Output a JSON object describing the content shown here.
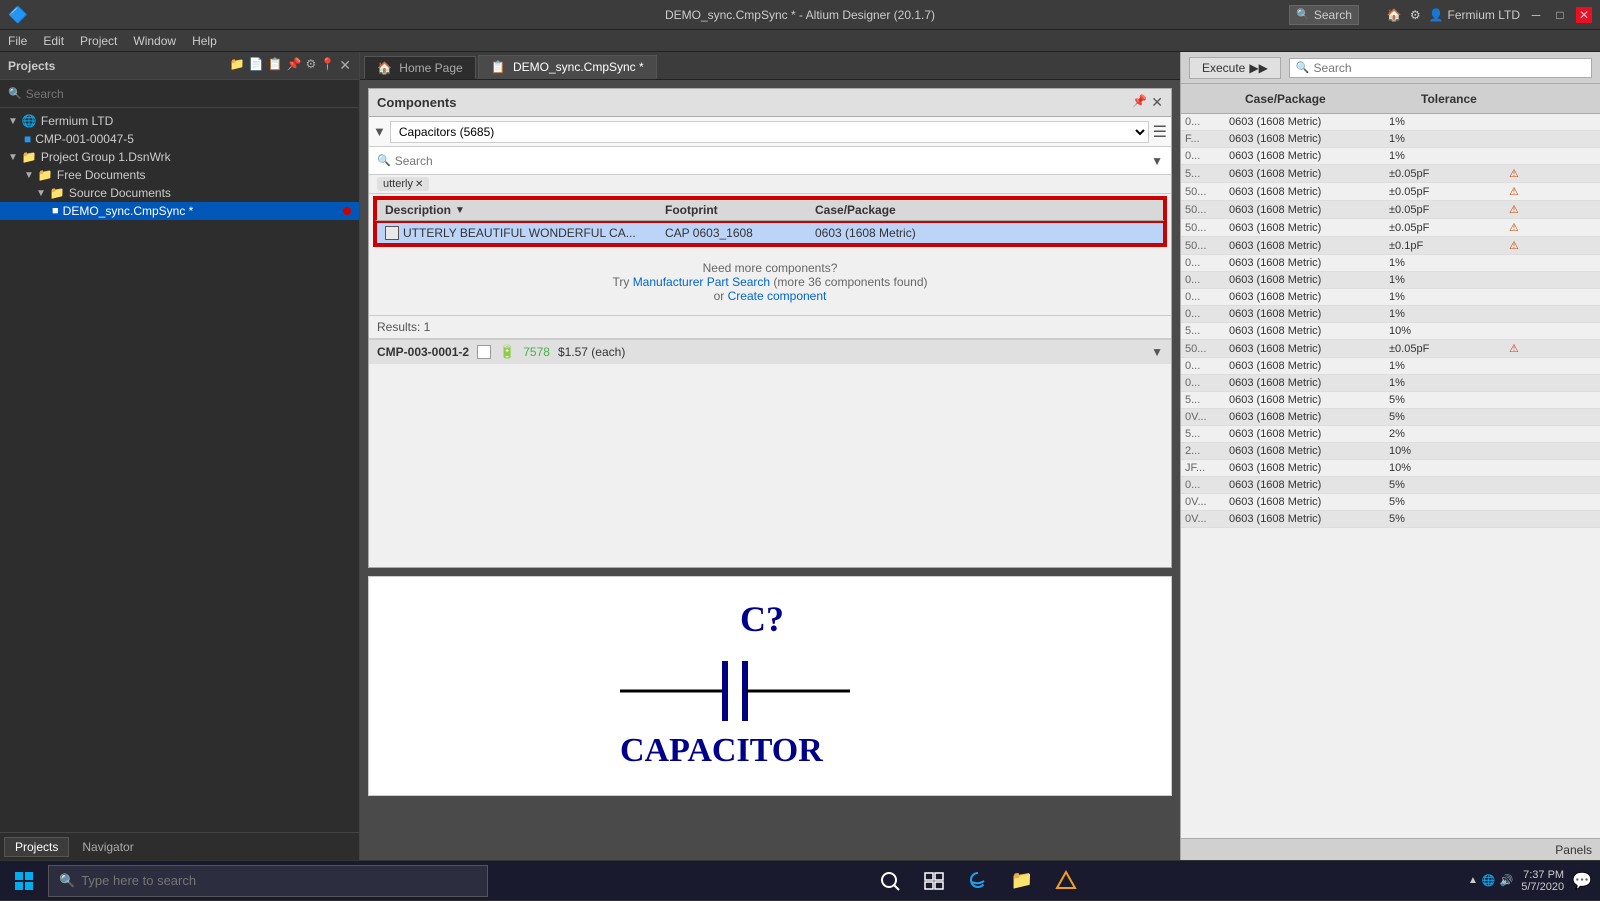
{
  "window": {
    "title": "DEMO_sync.CmpSync * - Altium Designer (20.1.7)"
  },
  "titlebar": {
    "search_placeholder": "Search",
    "search_label": "Search",
    "user": "Fermium LTD",
    "min": "─",
    "max": "□",
    "close": "✕"
  },
  "menubar": {
    "items": [
      "File",
      "Edit",
      "Project",
      "Window",
      "Help"
    ]
  },
  "left_panel": {
    "title": "Projects",
    "search_placeholder": "Search",
    "tree": [
      {
        "label": "Fermium LTD",
        "level": 0,
        "type": "company"
      },
      {
        "label": "CMP-001-00047-5",
        "level": 1,
        "type": "file-blue"
      },
      {
        "label": "Project Group 1.DsnWrk",
        "level": 0,
        "type": "project"
      },
      {
        "label": "Free Documents",
        "level": 1,
        "type": "folder"
      },
      {
        "label": "Source Documents",
        "level": 2,
        "type": "folder"
      },
      {
        "label": "DEMO_sync.CmpSync *",
        "level": 3,
        "type": "file-selected"
      }
    ],
    "tabs": [
      "Projects",
      "Navigator"
    ]
  },
  "components_panel": {
    "title": "Components",
    "filter_value": "Capacitors  (5685)",
    "search_placeholder": "Search",
    "filter_tag": "utterly",
    "table_headers": [
      "Description",
      "Footprint",
      "Case/Package"
    ],
    "table_row": {
      "description": "UTTERLY BEAUTIFUL WONDERFUL CA...",
      "footprint": "CAP 0603_1608",
      "case_package": "0603 (1608 Metric)"
    },
    "more_text": "Need more components?",
    "more_link1": "Manufacturer Part Search",
    "more_link1_suffix": " (more 36 components found)",
    "more_or": "or",
    "more_link2": "Create component",
    "results": "Results: 1",
    "detail": {
      "id": "CMP-003-0001-2",
      "stock_icon": "🔋",
      "stock": "7578",
      "price": "$1.57 (each)"
    }
  },
  "right_panel": {
    "execute_label": "Execute",
    "search_placeholder": "Search",
    "col1": "Case/Package",
    "col2": "Tolerance",
    "rows": [
      {
        "col1": "0603 (1608 Metric)",
        "col2": "1%",
        "prefix": "0...",
        "warning": false
      },
      {
        "col1": "0603 (1608 Metric)",
        "col2": "1%",
        "prefix": "F...",
        "warning": false
      },
      {
        "col1": "0603 (1608 Metric)",
        "col2": "1%",
        "prefix": "0...",
        "warning": false
      },
      {
        "col1": "0603 (1608 Metric)",
        "col2": "±0.05pF",
        "prefix": "5...",
        "warning": true
      },
      {
        "col1": "0603 (1608 Metric)",
        "col2": "±0.05pF",
        "prefix": "50...",
        "warning": true
      },
      {
        "col1": "0603 (1608 Metric)",
        "col2": "±0.05pF",
        "prefix": "50...",
        "warning": true
      },
      {
        "col1": "0603 (1608 Metric)",
        "col2": "±0.05pF",
        "prefix": "50...",
        "warning": true
      },
      {
        "col1": "0603 (1608 Metric)",
        "col2": "±0.1pF",
        "prefix": "50...",
        "warning": true
      },
      {
        "col1": "0603 (1608 Metric)",
        "col2": "1%",
        "prefix": "0...",
        "warning": false
      },
      {
        "col1": "0603 (1608 Metric)",
        "col2": "1%",
        "prefix": "0...",
        "warning": false
      },
      {
        "col1": "0603 (1608 Metric)",
        "col2": "1%",
        "prefix": "0...",
        "warning": false
      },
      {
        "col1": "0603 (1608 Metric)",
        "col2": "1%",
        "prefix": "0...",
        "warning": false
      },
      {
        "col1": "0603 (1608 Metric)",
        "col2": "10%",
        "prefix": "5...",
        "warning": false
      },
      {
        "col1": "0603 (1608 Metric)",
        "col2": "±0.05pF",
        "prefix": "50...",
        "warning": true
      },
      {
        "col1": "0603 (1608 Metric)",
        "col2": "1%",
        "prefix": "0...",
        "warning": false
      },
      {
        "col1": "0603 (1608 Metric)",
        "col2": "1%",
        "prefix": "0...",
        "warning": false
      },
      {
        "col1": "0603 (1608 Metric)",
        "col2": "5%",
        "prefix": "5...",
        "warning": false
      },
      {
        "col1": "0603 (1608 Metric)",
        "col2": "5%",
        "prefix": "0V...",
        "warning": false
      },
      {
        "col1": "0603 (1608 Metric)",
        "col2": "2%",
        "prefix": "5...",
        "warning": false
      },
      {
        "col1": "0603 (1608 Metric)",
        "col2": "10%",
        "prefix": "2...",
        "warning": false
      },
      {
        "col1": "0603 (1608 Metric)",
        "col2": "10%",
        "prefix": "JF...",
        "warning": false
      },
      {
        "col1": "0603 (1608 Metric)",
        "col2": "5%",
        "prefix": "0...",
        "warning": false
      },
      {
        "col1": "0603 (1608 Metric)",
        "col2": "5%",
        "prefix": "0V...",
        "warning": false
      },
      {
        "col1": "0603 (1608 Metric)",
        "col2": "5%",
        "prefix": "0V...",
        "warning": false
      }
    ]
  },
  "capacitor": {
    "symbol": "C?",
    "label": "CAPACITOR"
  },
  "taskbar": {
    "search_placeholder": "Type here to search",
    "time": "7:37 PM",
    "date": "5/7/2020",
    "panels_label": "Panels"
  }
}
